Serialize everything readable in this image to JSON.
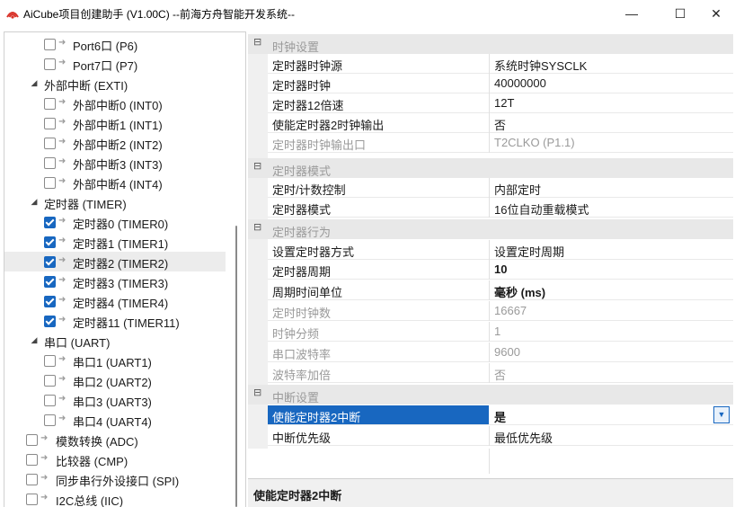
{
  "window": {
    "title": "AiCube项目创建助手 (V1.00C) --前海方舟智能开发系统--",
    "minimize_glyph": "—",
    "maximize_glyph": "☐",
    "close_glyph": "✕"
  },
  "tree": {
    "items": [
      {
        "label": "Port6口 (P6)"
      },
      {
        "label": "Port7口 (P7)"
      },
      {
        "label": "外部中断 (EXTI)"
      },
      {
        "label": "外部中断0 (INT0)"
      },
      {
        "label": "外部中断1 (INT1)"
      },
      {
        "label": "外部中断2 (INT2)"
      },
      {
        "label": "外部中断3 (INT3)"
      },
      {
        "label": "外部中断4 (INT4)"
      },
      {
        "label": "定时器 (TIMER)"
      },
      {
        "label": "定时器0 (TIMER0)"
      },
      {
        "label": "定时器1 (TIMER1)"
      },
      {
        "label": "定时器2 (TIMER2)"
      },
      {
        "label": "定时器3 (TIMER3)"
      },
      {
        "label": "定时器4 (TIMER4)"
      },
      {
        "label": "定时器11 (TIMER11)"
      },
      {
        "label": "串口 (UART)"
      },
      {
        "label": "串口1 (UART1)"
      },
      {
        "label": "串口2 (UART2)"
      },
      {
        "label": "串口3 (UART3)"
      },
      {
        "label": "串口4 (UART4)"
      },
      {
        "label": "模数转换 (ADC)"
      },
      {
        "label": "比较器 (CMP)"
      },
      {
        "label": "同步串行外设接口 (SPI)"
      },
      {
        "label": "I2C总线 (IIC)"
      }
    ],
    "collapse_glyph": "◢",
    "arrow_glyph": "➜"
  },
  "properties": {
    "categories": [
      {
        "label": "时钟设置"
      },
      {
        "label": "定时器模式"
      },
      {
        "label": "定时器行为"
      },
      {
        "label": "中断设置"
      }
    ],
    "toggle_glyph": "⊟",
    "rows": [
      {
        "name": "定时器时钟源",
        "value": "系统时钟SYSCLK"
      },
      {
        "name": "定时器时钟",
        "value": "40000000"
      },
      {
        "name": "定时器12倍速",
        "value": "12T"
      },
      {
        "name": "使能定时器2时钟输出",
        "value": "否"
      },
      {
        "name": "定时器时钟输出口",
        "value": "T2CLKO (P1.1)"
      },
      {
        "name": "定时/计数控制",
        "value": "内部定时"
      },
      {
        "name": "定时器模式",
        "value": "16位自动重载模式"
      },
      {
        "name": "设置定时器方式",
        "value": "设置定时周期"
      },
      {
        "name": "定时器周期",
        "value": "10"
      },
      {
        "name": "周期时间单位",
        "value": "毫秒 (ms)"
      },
      {
        "name": "定时时钟数",
        "value": "16667"
      },
      {
        "name": "时钟分频",
        "value": "1"
      },
      {
        "name": "串口波特率",
        "value": "9600"
      },
      {
        "name": "波特率加倍",
        "value": "否"
      },
      {
        "name": "使能定时器2中断",
        "value": "是"
      },
      {
        "name": "中断优先级",
        "value": "最低优先级"
      }
    ],
    "dropdown_glyph": "▼"
  },
  "description": {
    "title": "使能定时器2中断"
  },
  "colors": {
    "selection": "#1867c0",
    "category_bg": "#e8e8e8",
    "disabled_text": "#9a9a9a"
  }
}
